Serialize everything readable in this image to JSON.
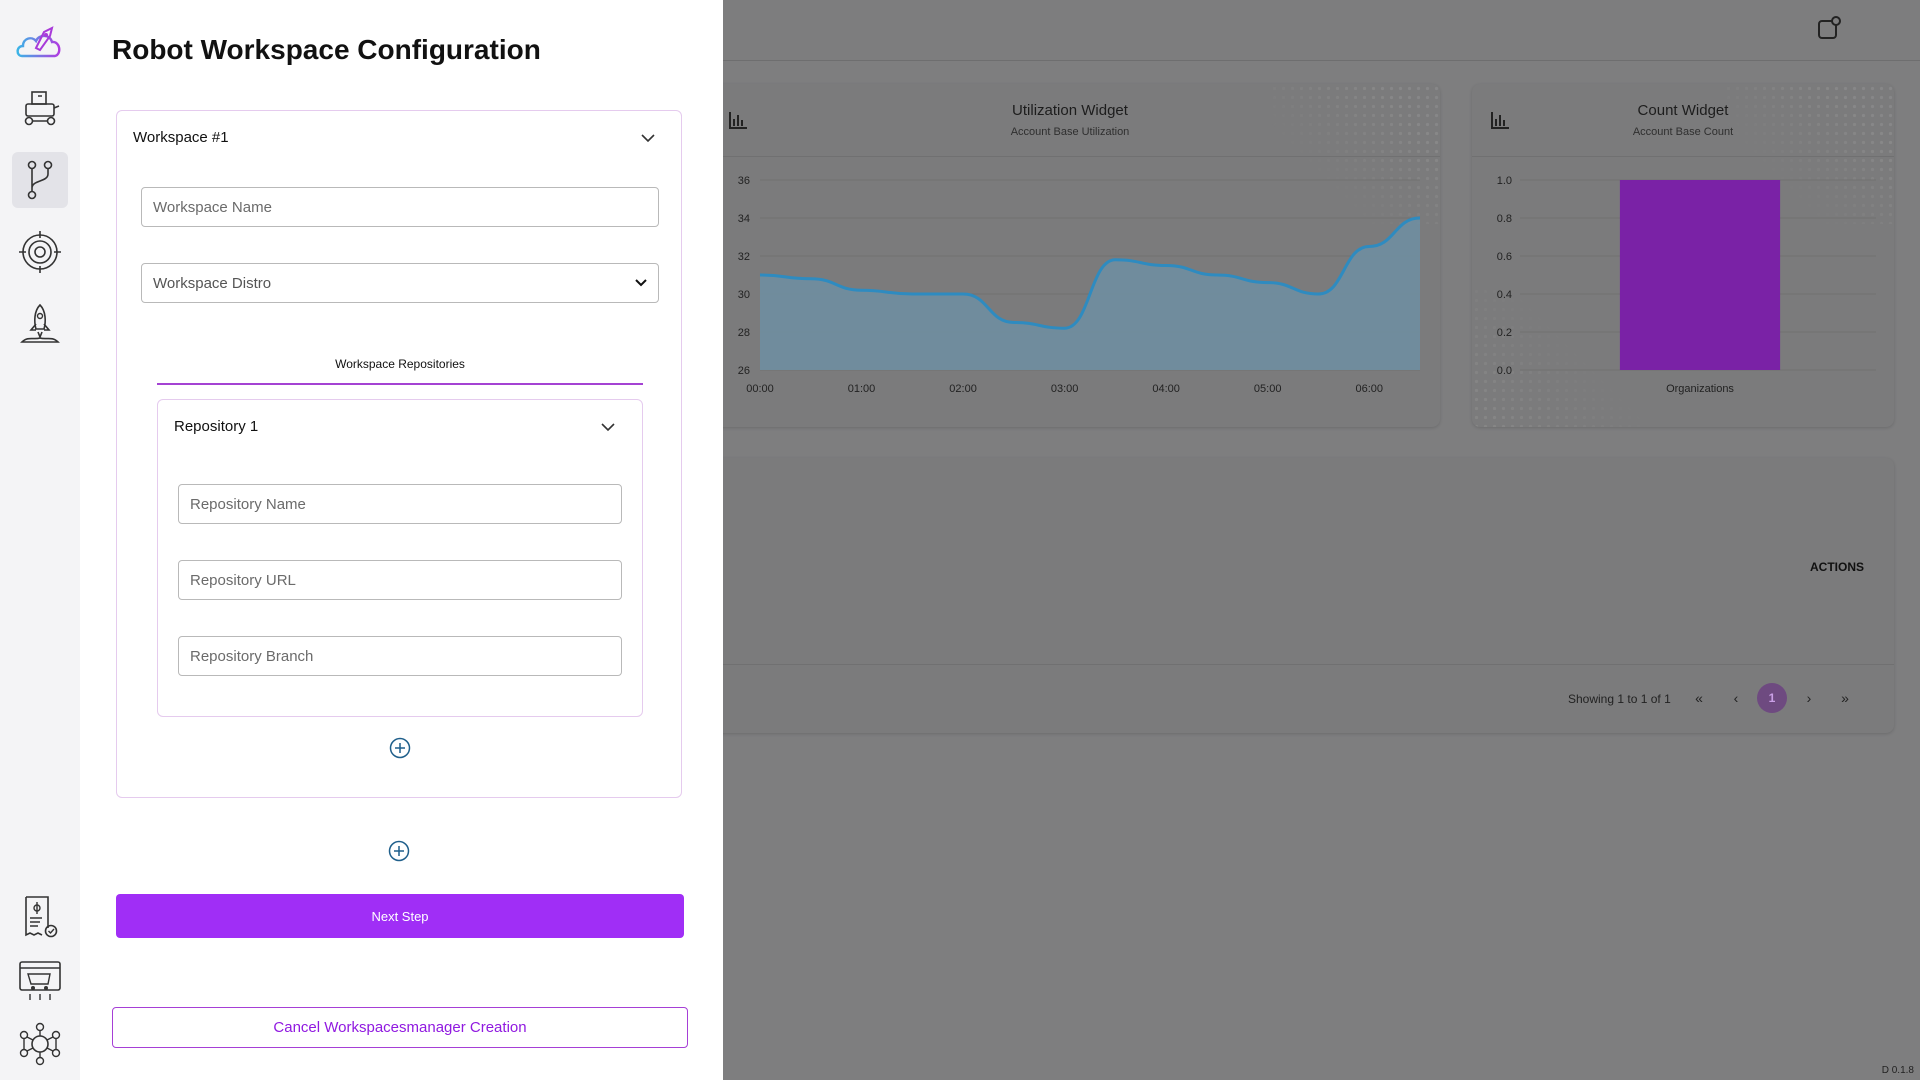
{
  "drawer": {
    "title": "Robot Workspace Configuration",
    "workspace": {
      "header": "Workspace #1",
      "name_placeholder": "Workspace Name",
      "distro_placeholder": "Workspace Distro",
      "repositories_tab": "Workspace Repositories",
      "repository": {
        "header": "Repository 1",
        "name_placeholder": "Repository Name",
        "url_placeholder": "Repository URL",
        "branch_placeholder": "Repository Branch"
      }
    },
    "next_label": "Next Step",
    "cancel_label": "Cancel Workspacesmanager Creation"
  },
  "sidebar": {
    "items": [
      "rocket-cloud-logo",
      "robot-icon",
      "git-branch-icon",
      "target-icon",
      "rocket-launch-icon"
    ],
    "bottom_items": [
      "billing-icon",
      "marketplace-icon",
      "network-icon"
    ],
    "active": "git-branch-icon"
  },
  "background": {
    "utilization_widget": {
      "title": "Utilization Widget",
      "subtitle": "Account Base Utilization"
    },
    "count_widget": {
      "title": "Count Widget",
      "subtitle": "Account Base Count"
    },
    "table": {
      "actions_header": "ACTIONS",
      "showing": "Showing 1 to 1 of 1",
      "page": "1"
    },
    "version": "D 0.1.8"
  },
  "chart_data": [
    {
      "type": "area",
      "title": "Utilization Widget",
      "subtitle": "Account Base Utilization",
      "x": [
        "00:00",
        "00:30",
        "01:00",
        "01:30",
        "02:00",
        "02:30",
        "03:00",
        "03:30",
        "04:00",
        "04:30",
        "05:00",
        "05:30",
        "06:00",
        "06:30"
      ],
      "values": [
        31,
        30.8,
        30.2,
        30,
        30,
        28.5,
        28.2,
        31.8,
        31.5,
        31,
        30.6,
        30,
        32.5,
        34
      ],
      "xticks": [
        "00:00",
        "01:00",
        "02:00",
        "03:00",
        "04:00",
        "05:00",
        "06:00"
      ],
      "yticks": [
        26,
        28,
        30,
        32,
        34,
        36
      ],
      "ylim": [
        26,
        36
      ],
      "grid": true,
      "color": "#2e8bc0"
    },
    {
      "type": "bar",
      "title": "Count Widget",
      "subtitle": "Account Base Count",
      "categories": [
        "Organizations"
      ],
      "values": [
        1
      ],
      "yticks": [
        "0.0",
        "0.2",
        "0.4",
        "0.6",
        "0.8",
        "1.0"
      ],
      "ylim": [
        0,
        1
      ],
      "grid": true,
      "color": "#7a22a6"
    }
  ]
}
